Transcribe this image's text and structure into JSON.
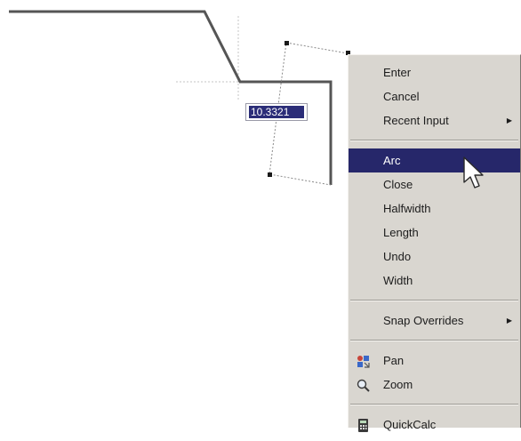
{
  "dynamic_input": {
    "value": "10.3321"
  },
  "context_menu": {
    "groups": [
      [
        {
          "label": "Enter",
          "icon": null,
          "submenu": false
        },
        {
          "label": "Cancel",
          "icon": null,
          "submenu": false
        },
        {
          "label": "Recent Input",
          "icon": null,
          "submenu": true
        }
      ],
      [
        {
          "label": "Arc",
          "icon": null,
          "submenu": false,
          "highlighted": true
        },
        {
          "label": "Close",
          "icon": null,
          "submenu": false
        },
        {
          "label": "Halfwidth",
          "icon": null,
          "submenu": false
        },
        {
          "label": "Length",
          "icon": null,
          "submenu": false
        },
        {
          "label": "Undo",
          "icon": null,
          "submenu": false
        },
        {
          "label": "Width",
          "icon": null,
          "submenu": false
        }
      ],
      [
        {
          "label": "Snap Overrides",
          "icon": null,
          "submenu": true
        }
      ],
      [
        {
          "label": "Pan",
          "icon": "pan-icon",
          "submenu": false
        },
        {
          "label": "Zoom",
          "icon": "zoom-icon",
          "submenu": false
        }
      ],
      [
        {
          "label": "QuickCalc",
          "icon": "calculator-icon",
          "submenu": false
        }
      ]
    ]
  },
  "colors": {
    "menu_background": "#d9d6d0",
    "highlight": "#26276a",
    "drawing_line": "#555555",
    "grip": "#1a1a1a"
  }
}
